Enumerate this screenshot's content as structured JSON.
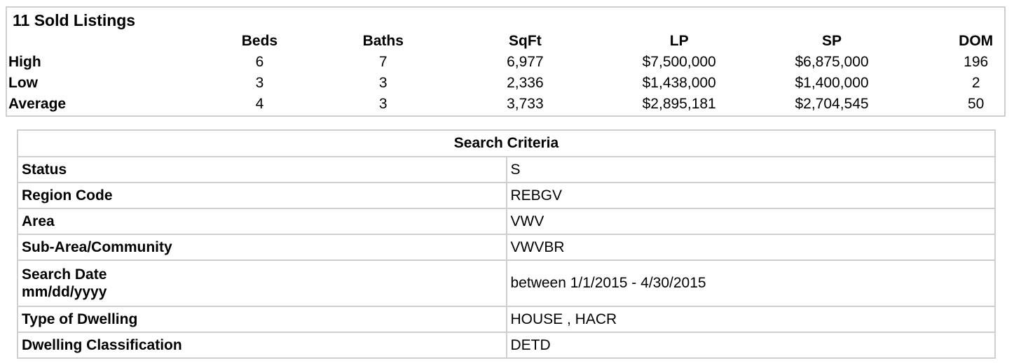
{
  "summary": {
    "title": "11 Sold Listings",
    "columns": [
      "Beds",
      "Baths",
      "SqFt",
      "LP",
      "SP",
      "DOM"
    ],
    "rows": [
      {
        "label": "High",
        "values": [
          "6",
          "7",
          "6,977",
          "$7,500,000",
          "$6,875,000",
          "196"
        ]
      },
      {
        "label": "Low",
        "values": [
          "3",
          "3",
          "2,336",
          "$1,438,000",
          "$1,400,000",
          "2"
        ]
      },
      {
        "label": "Average",
        "values": [
          "4",
          "3",
          "3,733",
          "$2,895,181",
          "$2,704,545",
          "50"
        ]
      }
    ]
  },
  "criteria": {
    "heading": "Search Criteria",
    "items": [
      {
        "label": "Status",
        "value": "S"
      },
      {
        "label": "Region Code",
        "value": "REBGV"
      },
      {
        "label": "Area",
        "value": "VWV"
      },
      {
        "label": "Sub-Area/Community",
        "value": "VWVBR"
      },
      {
        "label_line1": "Search Date",
        "label_line2": "mm/dd/yyyy",
        "value": "between 1/1/2015 - 4/30/2015"
      },
      {
        "label": "Type of Dwelling",
        "value": "HOUSE , HACR"
      },
      {
        "label": "Dwelling Classification",
        "value": "DETD"
      }
    ]
  }
}
